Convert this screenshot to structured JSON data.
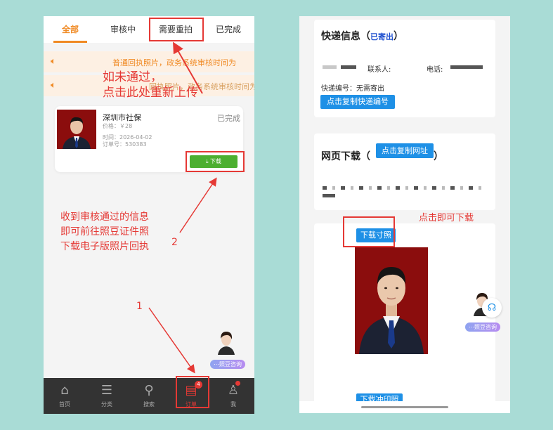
{
  "left_phone": {
    "tabs": [
      "全部",
      "审核中",
      "需要重拍",
      "已完成"
    ],
    "notices": [
      "普通回执照片，政务系统审核时间为",
      "回执照片，政务系统审核时间为"
    ],
    "notice_icon": "speaker-icon",
    "annotation_top": [
      "如未通过，",
      "点击此处重新上传"
    ],
    "order": {
      "title": "深圳市社保",
      "status": "已完成",
      "price": "价格：￥28",
      "time": "时间：2026-04-02",
      "order_no": "订单号：530383",
      "download_label": "下载"
    },
    "annotation_middle": [
      "收到审核通过的信息",
      "即可前往照豆证件照",
      "下载电子版照片回执"
    ],
    "annotation_number_2": "2",
    "annotation_number_1": "1",
    "consult_label": "照豆咨询",
    "bottom_nav": [
      {
        "label": "首页",
        "icon": "home-icon"
      },
      {
        "label": "分类",
        "icon": "category-icon"
      },
      {
        "label": "搜索",
        "icon": "search-icon"
      },
      {
        "label": "订单",
        "icon": "order-icon",
        "badge": "4"
      },
      {
        "label": "我",
        "icon": "user-icon"
      }
    ]
  },
  "right_phone": {
    "express": {
      "title": "快递信息（",
      "status": "已寄出",
      "title_end": "）",
      "contact_label": "联系人:",
      "phone_label": "电话:",
      "tracking": "快递编号：无需寄出",
      "copy_tracking_button": "点击复制快递编号"
    },
    "web_download": {
      "title": "网页下载（",
      "copy_url_button": "点击复制网址",
      "title_end": "）"
    },
    "annotation": "点击即可下载",
    "download_photo_button": "下载寸照",
    "download_print_button": "下载冲印照",
    "consult_label": "照豆咨询"
  },
  "colors": {
    "background": "#a9dcd6",
    "accent_orange": "#f08a24",
    "annotation_red": "#e53935",
    "button_blue": "#1e90e6",
    "download_green": "#4caf30",
    "photo_background": "#8b0d0d"
  }
}
